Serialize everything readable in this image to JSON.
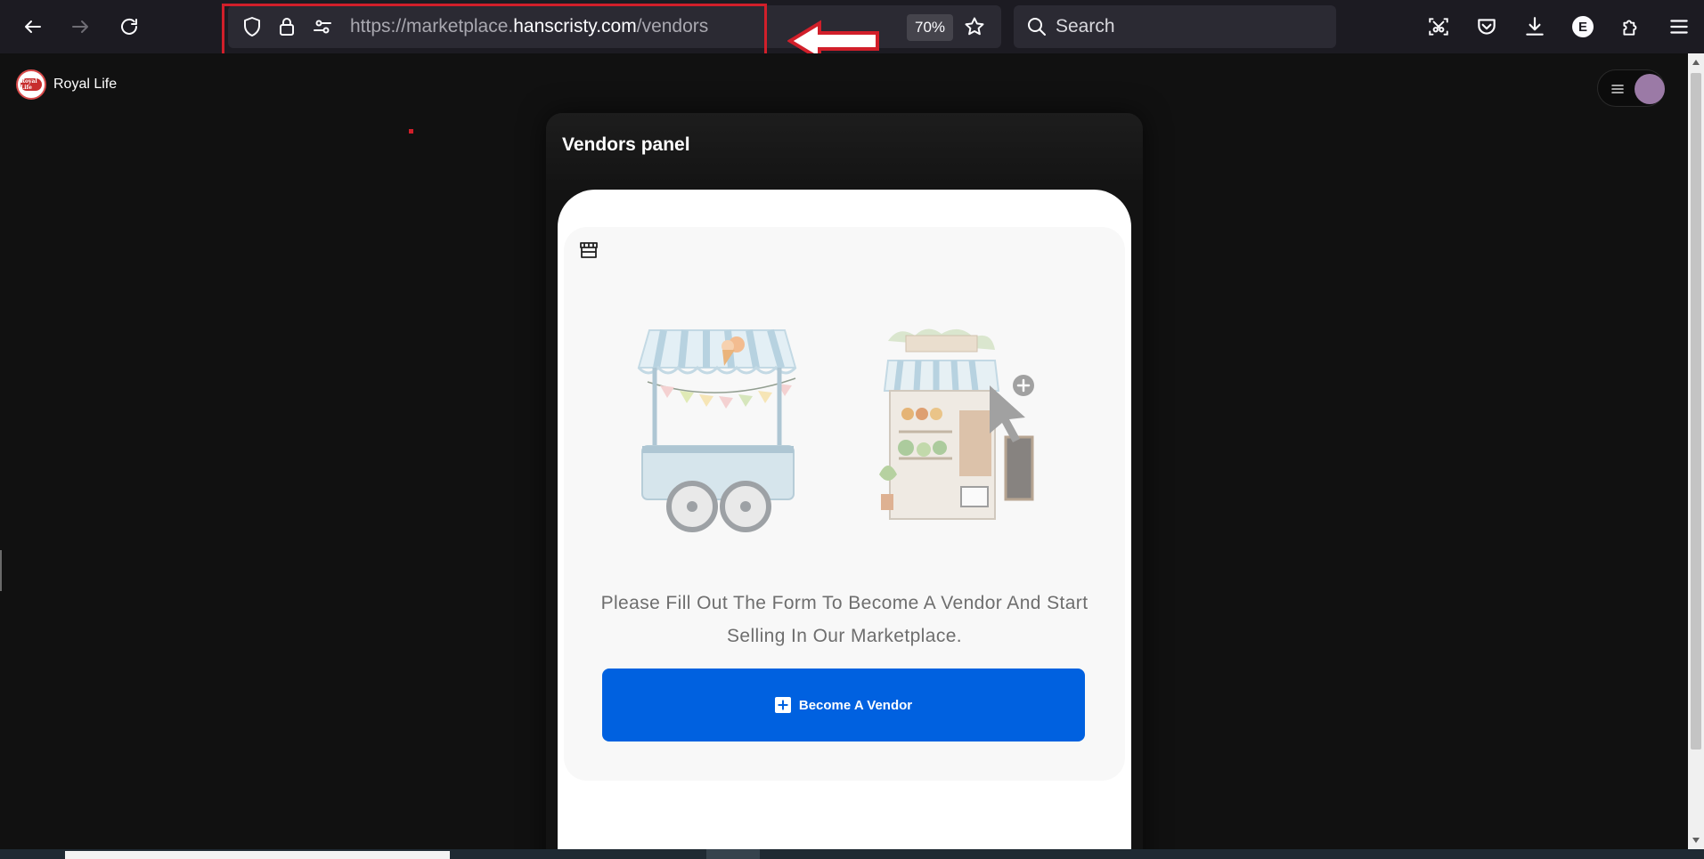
{
  "browser": {
    "url_prefix": "https://marketplace.",
    "url_domain": "hanscristy.com",
    "url_path": "/vendors",
    "zoom": "70%",
    "search_placeholder": "Search",
    "account_initial": "E",
    "colors": {
      "toolbar": "#1c1b22",
      "field": "#2b2a33",
      "annotation_red": "#d11f2a"
    }
  },
  "site": {
    "brand_name": "Royal Life",
    "logo_text": "Royal Life"
  },
  "panel": {
    "title": "Vendors panel",
    "description": "Please Fill Out The Form To Become A Vendor And Start Selling In Our Marketplace.",
    "button_label": "Become A Vendor",
    "accent_color": "#0061e0"
  }
}
